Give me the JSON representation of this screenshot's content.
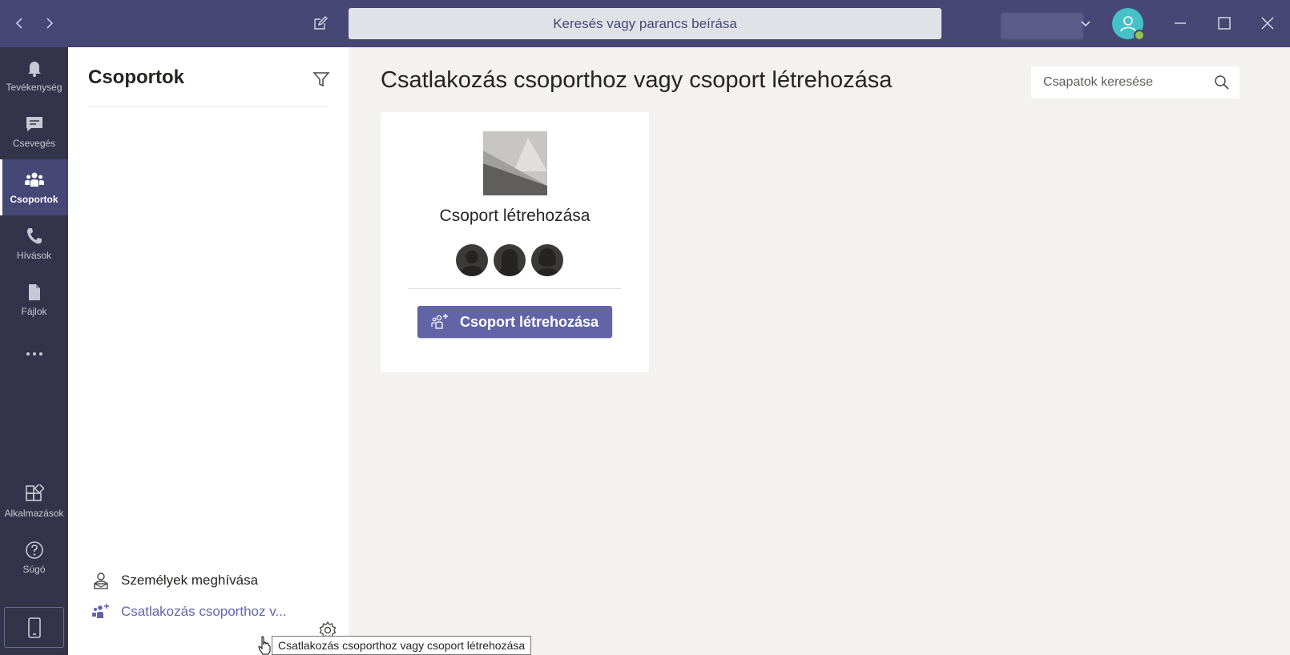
{
  "titlebar": {
    "search_placeholder": "Keresés vagy parancs beírása"
  },
  "rail": {
    "items": [
      {
        "label": "Tevékenység",
        "icon": "bell-icon"
      },
      {
        "label": "Csevegés",
        "icon": "chat-icon"
      },
      {
        "label": "Csoportok",
        "icon": "teams-icon",
        "active": true
      },
      {
        "label": "Hívások",
        "icon": "phone-icon"
      },
      {
        "label": "Fájlok",
        "icon": "file-icon"
      },
      {
        "label": "",
        "icon": "more-icon"
      }
    ],
    "bottom_items": [
      {
        "label": "Alkalmazások",
        "icon": "apps-icon"
      },
      {
        "label": "Súgó",
        "icon": "help-icon"
      }
    ]
  },
  "panel": {
    "title": "Csoportok",
    "invite_label": "Személyek meghívása",
    "join_label": "Csatlakozás csoporthoz v..."
  },
  "main": {
    "title": "Csatlakozás csoporthoz vagy csoport létrehozása",
    "team_search_placeholder": "Csapatok keresése",
    "card": {
      "title": "Csoport létrehozása",
      "button_label": "Csoport létrehozása"
    }
  },
  "tooltip": {
    "text": "Csatlakozás csoporthoz vagy csoport létrehozása"
  },
  "colors": {
    "titlebar": "#464775",
    "rail": "#33344a",
    "accent": "#6264a7",
    "avatar": "#45c1c8",
    "presence": "#92c353"
  }
}
